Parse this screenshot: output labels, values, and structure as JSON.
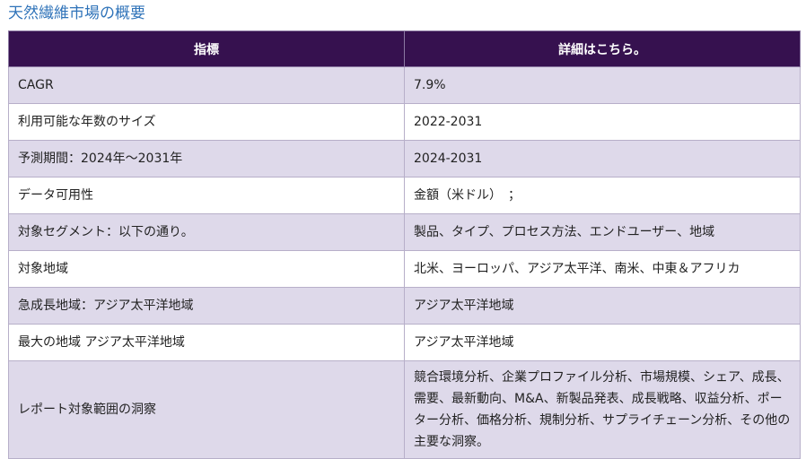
{
  "page": {
    "title": "天然繊維市場の概要"
  },
  "table": {
    "headers": [
      "指標",
      "詳細はこちら。"
    ],
    "rows": [
      [
        "CAGR",
        "7.9%"
      ],
      [
        "利用可能な年数のサイズ",
        "2022-2031"
      ],
      [
        "予測期間：2024年～2031年",
        "2024-2031"
      ],
      [
        "データ可用性",
        "金額（米ドル）　；"
      ],
      [
        "対象セグメント：以下の通り。",
        "製品、タイプ、プロセス方法、エンドユーザー、地域"
      ],
      [
        "対象地域",
        "北米、ヨーロッパ、アジア太平洋、南米、中東＆アフリカ"
      ],
      [
        "急成長地域：アジア太平洋地域",
        "アジア太平洋地域"
      ],
      [
        "最大の地域 アジア太平洋地域",
        "アジア太平洋地域"
      ],
      [
        "レポート対象範囲の洞察",
        "競合環境分析、企業プロファイル分析、市場規模、シェア、成長、需要、最新動向、M&A、新製品発表、成長戦略、収益分析、ポーター分析、価格分析、規制分析、サプライチェーン分析、その他の主要な洞察。"
      ]
    ]
  },
  "colors": {
    "title": "#2f73b9",
    "header_bg": "#36114f",
    "header_text": "#ffffff",
    "row_alt_bg": "#ded9ea",
    "row_bg": "#ffffff",
    "border": "#b7afc9"
  }
}
